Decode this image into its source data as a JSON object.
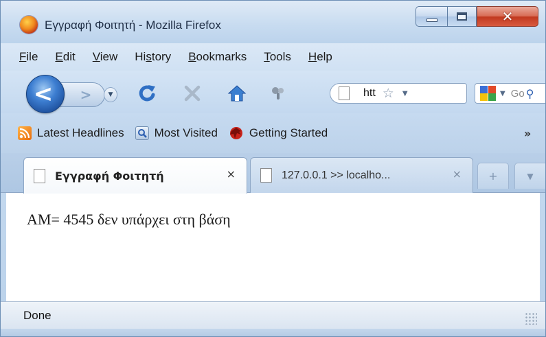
{
  "window": {
    "title": "Εγγραφή Φοιτητή - Mozilla Firefox",
    "controls": {
      "minimize": "minimize-icon",
      "maximize": "maximize-icon",
      "close": "✕"
    }
  },
  "menu": {
    "items": [
      {
        "key": "F",
        "rest": "ile"
      },
      {
        "key": "E",
        "rest": "dit"
      },
      {
        "key": "V",
        "rest": "iew"
      },
      {
        "pre": "Hi",
        "key": "s",
        "rest": "tory"
      },
      {
        "key": "B",
        "rest": "ookmarks"
      },
      {
        "key": "T",
        "rest": "ools"
      },
      {
        "key": "H",
        "rest": "elp"
      }
    ]
  },
  "navigation": {
    "url": "htt",
    "search_placeholder": "Go"
  },
  "bookmarks": {
    "items": [
      "Latest Headlines",
      "Most Visited",
      "Getting Started"
    ],
    "overflow": "»"
  },
  "tabs": [
    {
      "label": "Εγγραφή Φοιτητή",
      "active": true,
      "close": "×"
    },
    {
      "label": "127.0.0.1 >> localho...",
      "active": false,
      "close": "×"
    }
  ],
  "content": {
    "message": "AM= 4545 δεν υπάρχει στη βάση"
  },
  "status": {
    "text": "Done"
  },
  "colors": {
    "chrome_blue": "#c3d8ef",
    "close_red": "#c0381e",
    "back_button_blue": "#3d7ed1"
  }
}
